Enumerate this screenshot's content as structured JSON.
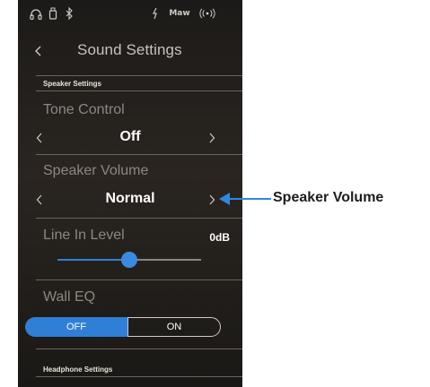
{
  "status_bar": {
    "icons": [
      "headphones-icon",
      "usb-memory-icon",
      "bluetooth-icon",
      "audio-file-icon",
      "midi-icon",
      "wireless-icon"
    ],
    "midi_text": "Maw"
  },
  "header": {
    "title": "Sound Settings"
  },
  "speaker_settings": {
    "section_label": "Speaker Settings",
    "tone_control": {
      "label": "Tone Control",
      "value": "Off"
    },
    "speaker_volume": {
      "label": "Speaker Volume",
      "value": "Normal"
    },
    "line_in_level": {
      "label": "Line In Level",
      "value": "0dB",
      "slider_fraction": 0.5
    },
    "wall_eq": {
      "label": "Wall EQ",
      "off_label": "OFF",
      "on_label": "ON",
      "selected": "OFF"
    }
  },
  "headphone_settings": {
    "section_label": "Headphone Settings"
  },
  "callout": {
    "label": "Speaker Volume"
  },
  "colors": {
    "accent": "#2f7fd6",
    "callout": "#2f88e0"
  }
}
